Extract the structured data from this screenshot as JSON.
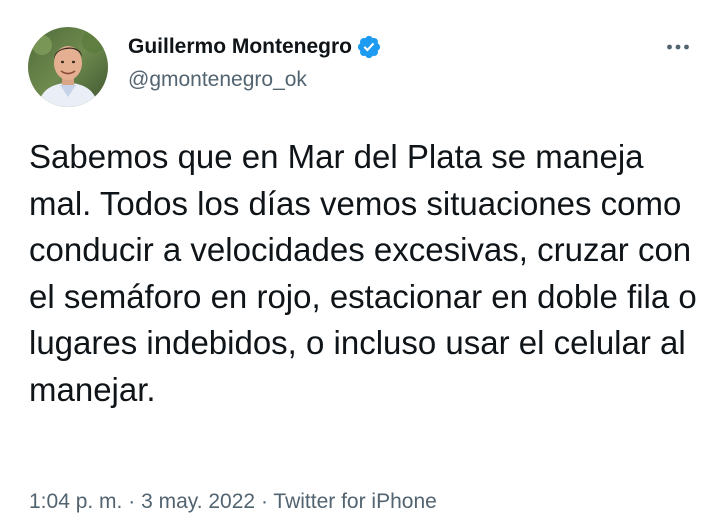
{
  "author": {
    "name": "Guillermo Montenegro",
    "handle": "@gmontenegro_ok",
    "verified": true,
    "avatar_icon": "profile-photo",
    "verified_icon": "verified-badge-icon"
  },
  "menu": {
    "icon": "more-horizontal-icon"
  },
  "tweet": {
    "text": "Sabemos que en Mar del Plata se maneja mal. Todos los días vemos situaciones como conducir a velocidades excesivas, cruzar con el semáforo en rojo, estacionar en doble fila o lugares indebidos, o incluso usar el celular al manejar."
  },
  "meta": {
    "time": "1:04 p. m.",
    "separator": "·",
    "date": "3 may. 2022",
    "source": "Twitter for iPhone"
  },
  "colors": {
    "text_primary": "#0f1419",
    "text_secondary": "#536471",
    "verified_blue": "#1d9bf0"
  }
}
